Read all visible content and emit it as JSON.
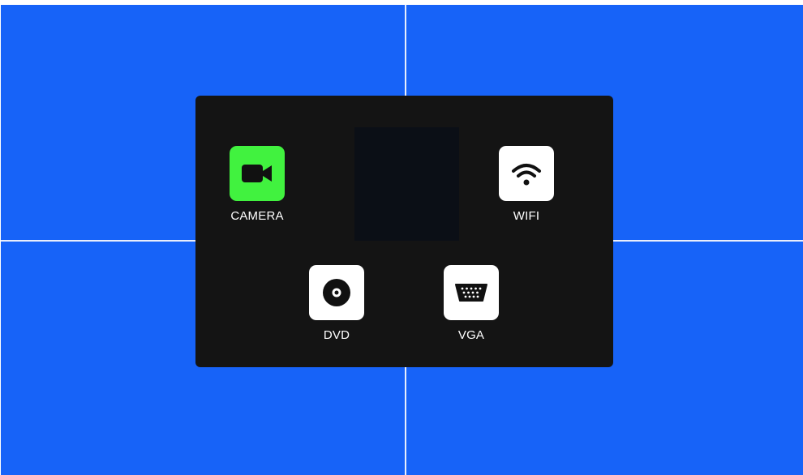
{
  "sources": [
    {
      "id": "camera",
      "label": "CAMERA",
      "icon": "video-camera-icon",
      "active": true
    },
    {
      "id": "wifi",
      "label": "WIFI",
      "icon": "wifi-icon",
      "active": false
    },
    {
      "id": "dvd",
      "label": "DVD",
      "icon": "disc-icon",
      "active": false
    },
    {
      "id": "vga",
      "label": "VGA",
      "icon": "vga-port-icon",
      "active": false
    }
  ],
  "colors": {
    "background": "#1763f8",
    "panel": "#141414",
    "active_tile": "#41f23f",
    "tile": "#ffffff"
  }
}
